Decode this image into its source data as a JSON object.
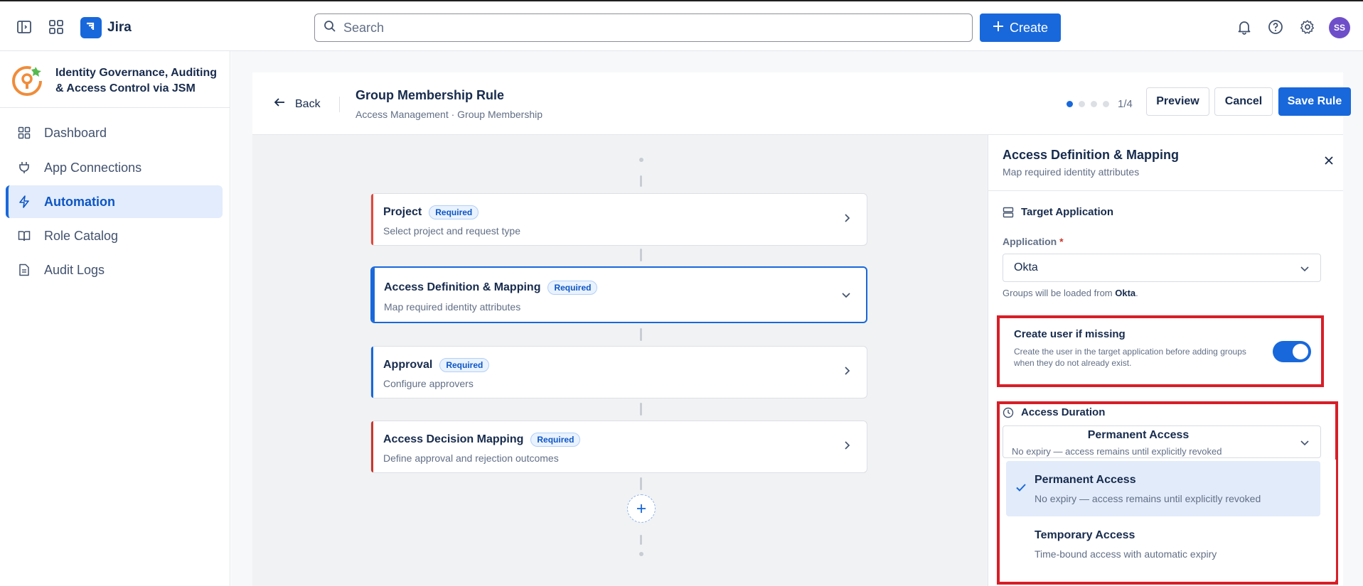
{
  "topbar": {
    "app_name": "Jira",
    "search_placeholder": "Search",
    "create_label": "Create",
    "avatar_initials": "SS"
  },
  "sidebar": {
    "app_title": "Identity Governance, Auditing & Access Control via JSM",
    "items": [
      {
        "label": "Dashboard",
        "icon": "grid-icon"
      },
      {
        "label": "App Connections",
        "icon": "plug-icon"
      },
      {
        "label": "Automation",
        "icon": "lightning-icon",
        "active": true
      },
      {
        "label": "Role Catalog",
        "icon": "book-icon"
      },
      {
        "label": "Audit Logs",
        "icon": "document-icon"
      }
    ]
  },
  "rule_header": {
    "back_label": "Back",
    "title": "Group Membership Rule",
    "subtitle": "Access Management · Group Membership",
    "step_count": "1/4",
    "preview_label": "Preview",
    "cancel_label": "Cancel",
    "save_label": "Save Rule"
  },
  "steps": [
    {
      "title": "Project",
      "badge": "Required",
      "subtitle": "Select project and request type",
      "accent": "#e2483d"
    },
    {
      "title": "Access Definition & Mapping",
      "badge": "Required",
      "subtitle": "Map required identity attributes",
      "accent": "#1868db",
      "selected": true
    },
    {
      "title": "Approval",
      "badge": "Required",
      "subtitle": "Configure approvers",
      "accent": "#1868db"
    },
    {
      "title": "Access Decision Mapping",
      "badge": "Required",
      "subtitle": "Define approval and rejection outcomes",
      "accent": "#c9372c"
    }
  ],
  "panel": {
    "title": "Access Definition & Mapping",
    "subtitle": "Map required identity attributes",
    "target_section": "Target Application",
    "application_label": "Application",
    "required_mark": "*",
    "application_value": "Okta",
    "hint_prefix": "Groups will be loaded from ",
    "hint_app": "Okta",
    "hint_suffix": ".",
    "toggle_title": "Create user if missing",
    "toggle_desc": "Create the user in the target application before adding groups when they do not already exist.",
    "toggle_on": true,
    "duration_section": "Access Duration",
    "duration_value": "Permanent Access",
    "duration_desc": "No expiry — access remains until explicitly revoked",
    "options": [
      {
        "title": "Permanent Access",
        "desc": "No expiry — access remains until explicitly revoked",
        "selected": true
      },
      {
        "title": "Temporary Access",
        "desc": "Time-bound access with automatic expiry",
        "selected": false
      }
    ]
  },
  "colors": {
    "brand": "#1868db",
    "highlight_box": "#d81e28"
  }
}
